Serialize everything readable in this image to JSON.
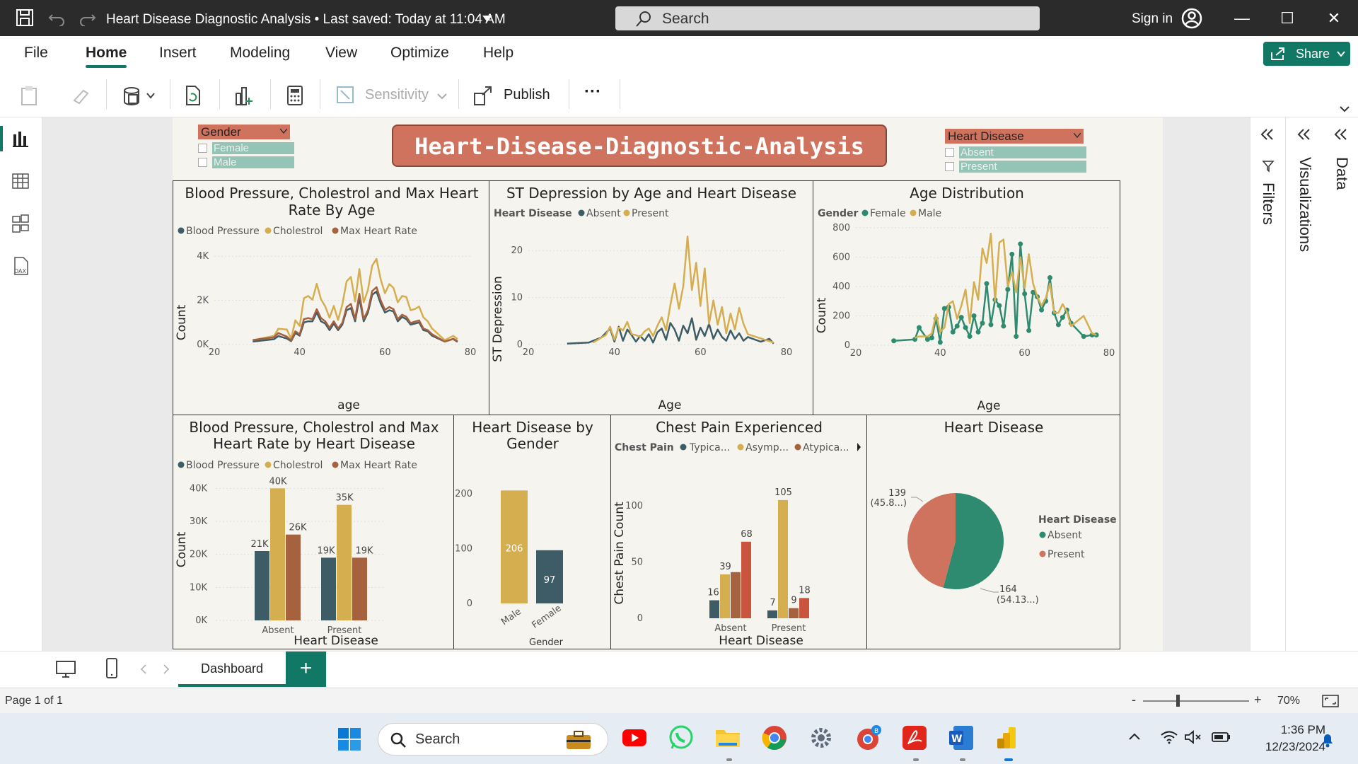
{
  "titlebar": {
    "doc_title": "Heart Disease Diagnostic Analysis",
    "saved_status": "Last saved: Today at 11:04 AM",
    "search_placeholder": "Search",
    "sign_in": "Sign in"
  },
  "menu": {
    "items": [
      "File",
      "Home",
      "Insert",
      "Modeling",
      "View",
      "Optimize",
      "Help"
    ],
    "active": "Home",
    "share": "Share"
  },
  "ribbon": {
    "sensitivity": "Sensitivity",
    "publish": "Publish",
    "more": "···"
  },
  "report": {
    "banner": "Heart-Disease-Diagnostic-Analysis",
    "slicers": [
      {
        "header": "Gender",
        "options": [
          "Female",
          "Male"
        ]
      },
      {
        "header": "Heart Disease",
        "options": [
          "Absent",
          "Present"
        ]
      }
    ]
  },
  "colors": {
    "teal_dark": "#3d5c66",
    "gold": "#d4ae4f",
    "brown": "#a6613f",
    "green": "#2e8b70",
    "salmon": "#d0735e",
    "orange_red": "#c9553f",
    "accent": "#117865"
  },
  "chart_data": [
    {
      "id": "bp_chol_maxhr_by_age",
      "type": "line",
      "title": "Blood Pressure, Cholestrol and Max Heart Rate By Age",
      "xlabel": "age",
      "ylabel": "Count",
      "xlim": [
        20,
        80
      ],
      "yticks": [
        "0K",
        "2K",
        "4K"
      ],
      "xticks": [
        "20",
        "40",
        "60",
        "80"
      ],
      "ylim": [
        0,
        5000
      ],
      "legend": [
        "Blood Pressure",
        "Cholestrol",
        "Max Heart Rate"
      ],
      "x": [
        29,
        34,
        35,
        37,
        38,
        39,
        40,
        41,
        42,
        43,
        44,
        45,
        46,
        47,
        48,
        49,
        50,
        51,
        52,
        53,
        54,
        55,
        56,
        57,
        58,
        59,
        60,
        61,
        62,
        63,
        64,
        65,
        66,
        67,
        68,
        69,
        70,
        71,
        74,
        76,
        77
      ],
      "series": [
        {
          "name": "Blood Pressure",
          "values": [
            130,
            240,
            380,
            270,
            150,
            520,
            400,
            1000,
            1050,
            1050,
            1450,
            1050,
            950,
            650,
            950,
            650,
            900,
            1550,
            1650,
            1050,
            2100,
            1050,
            1450,
            2250,
            2400,
            1850,
            1450,
            1550,
            1500,
            1050,
            1250,
            1150,
            900,
            950,
            1000,
            650,
            600,
            400,
            130,
            250,
            120
          ]
        },
        {
          "name": "Cholestrol",
          "values": [
            200,
            390,
            710,
            680,
            260,
            1100,
            840,
            2100,
            2200,
            2030,
            2750,
            2050,
            1720,
            1210,
            1750,
            1110,
            1810,
            2860,
            3060,
            1950,
            3420,
            1910,
            2470,
            3570,
            3880,
            2940,
            2320,
            2740,
            2560,
            1910,
            2200,
            2150,
            1550,
            1610,
            1720,
            1230,
            1050,
            730,
            200,
            390,
            250
          ]
        },
        {
          "name": "Max Heart Rate",
          "values": [
            200,
            330,
            520,
            360,
            180,
            600,
            460,
            1150,
            1200,
            1150,
            1600,
            1200,
            1050,
            750,
            1050,
            730,
            980,
            1690,
            1840,
            1150,
            2300,
            1150,
            1550,
            2420,
            2600,
            2000,
            1570,
            1700,
            1600,
            1150,
            1350,
            1260,
            970,
            1040,
            1090,
            720,
            650,
            470,
            130,
            260,
            150
          ]
        }
      ]
    },
    {
      "id": "st_depression_by_age",
      "type": "line",
      "title": "ST Depression by Age and Heart Disease",
      "xlabel": "Age",
      "ylabel": "ST Depression",
      "legend_title": "Heart Disease",
      "legend": [
        "Absent",
        "Present"
      ],
      "xlim": [
        20,
        80
      ],
      "ylim": [
        0,
        25
      ],
      "yticks": [
        "0",
        "10",
        "20"
      ],
      "xticks": [
        "20",
        "40",
        "60",
        "80"
      ],
      "series": [
        {
          "name": "Absent",
          "x": [
            29,
            34,
            37,
            39,
            40,
            41,
            42,
            43,
            44,
            45,
            46,
            47,
            48,
            49,
            50,
            51,
            52,
            53,
            54,
            55,
            56,
            57,
            58,
            59,
            60,
            61,
            62,
            63,
            64,
            65,
            66,
            67,
            68,
            69,
            70,
            71,
            74,
            76,
            77
          ],
          "values": [
            0.2,
            0.4,
            1.5,
            3.4,
            0.6,
            3.8,
            0.8,
            3.2,
            2.0,
            0.6,
            1.8,
            0.8,
            2.2,
            0.4,
            2.6,
            3.4,
            1.0,
            4.6,
            3.2,
            0.8,
            4.0,
            2.4,
            5.6,
            1.0,
            3.6,
            1.8,
            4.4,
            1.2,
            3.2,
            1.6,
            0.8,
            3.0,
            1.2,
            2.4,
            0.8,
            1.6,
            0.6,
            1.2,
            0.2
          ]
        },
        {
          "name": "Present",
          "x": [
            35,
            38,
            39,
            40,
            41,
            42,
            43,
            44,
            45,
            46,
            47,
            48,
            49,
            50,
            51,
            52,
            53,
            54,
            55,
            56,
            57,
            58,
            59,
            60,
            61,
            62,
            63,
            64,
            65,
            66,
            67,
            68,
            69,
            70,
            71,
            77
          ],
          "values": [
            0.4,
            2.0,
            3.8,
            1.0,
            3.6,
            3.0,
            4.8,
            2.2,
            2.0,
            1.6,
            2.8,
            3.4,
            1.8,
            4.0,
            5.8,
            3.0,
            8.4,
            13.0,
            7.6,
            12.4,
            23.0,
            11.6,
            17.4,
            8.2,
            16.2,
            4.4,
            9.4,
            4.2,
            8.0,
            2.4,
            6.6,
            3.2,
            7.8,
            4.4,
            2.2,
            0.4
          ]
        }
      ]
    },
    {
      "id": "age_distribution",
      "type": "line",
      "title": "Age Distribution",
      "xlabel": "Age",
      "ylabel": "Count",
      "legend_title": "Gender",
      "legend": [
        "Female",
        "Male"
      ],
      "xlim": [
        20,
        80
      ],
      "ylim": [
        0,
        800
      ],
      "yticks": [
        "0",
        "200",
        "400",
        "600",
        "800"
      ],
      "xticks": [
        "20",
        "40",
        "60",
        "80"
      ],
      "series": [
        {
          "name": "Female",
          "x": [
            29,
            34,
            35,
            37,
            38,
            39,
            40,
            41,
            42,
            43,
            44,
            45,
            46,
            47,
            48,
            49,
            50,
            51,
            52,
            53,
            54,
            55,
            56,
            57,
            58,
            59,
            60,
            61,
            62,
            63,
            64,
            65,
            66,
            67,
            68,
            69,
            70,
            71,
            74,
            76,
            77
          ],
          "values": [
            30,
            40,
            120,
            40,
            50,
            180,
            20,
            250,
            260,
            90,
            130,
            190,
            120,
            60,
            200,
            90,
            150,
            420,
            140,
            310,
            270,
            130,
            380,
            620,
            60,
            690,
            350,
            100,
            360,
            330,
            240,
            300,
            460,
            220,
            140,
            190,
            240,
            150,
            60,
            70,
            70
          ]
        },
        {
          "name": "Male",
          "x": [
            34,
            35,
            37,
            38,
            39,
            40,
            41,
            42,
            43,
            44,
            45,
            46,
            47,
            48,
            49,
            50,
            51,
            52,
            53,
            54,
            55,
            56,
            57,
            58,
            59,
            60,
            61,
            62,
            63,
            64,
            65,
            66,
            67,
            68,
            69,
            70,
            71,
            74,
            76,
            77
          ],
          "values": [
            50,
            60,
            60,
            80,
            210,
            90,
            120,
            280,
            300,
            180,
            270,
            380,
            150,
            430,
            310,
            660,
            560,
            760,
            300,
            700,
            720,
            400,
            500,
            360,
            600,
            390,
            620,
            420,
            330,
            270,
            320,
            420,
            220,
            220,
            280,
            230,
            130,
            200,
            80,
            70
          ]
        }
      ]
    },
    {
      "id": "bp_chol_maxhr_by_hd",
      "type": "bar",
      "title": "Blood Pressure, Cholestrol and Max Heart Rate by Heart Disease",
      "xlabel": "Heart Disease",
      "ylabel": "Count",
      "categories": [
        "Absent",
        "Present"
      ],
      "ylim": [
        0,
        45000
      ],
      "yticks": [
        "0K",
        "10K",
        "20K",
        "30K",
        "40K"
      ],
      "legend": [
        "Blood Pressure",
        "Cholestrol",
        "Max Heart Rate"
      ],
      "series": [
        {
          "name": "Blood Pressure",
          "values": [
            21000,
            19000
          ],
          "labels": [
            "21K",
            "19K"
          ]
        },
        {
          "name": "Cholestrol",
          "values": [
            40000,
            35000
          ],
          "labels": [
            "40K",
            "35K"
          ]
        },
        {
          "name": "Max Heart Rate",
          "values": [
            26000,
            19000
          ],
          "labels": [
            "26K",
            "19K"
          ]
        }
      ]
    },
    {
      "id": "hd_by_gender",
      "type": "bar",
      "title": "Heart Disease by Gender",
      "xlabel": "Gender",
      "categories": [
        "Male",
        "Female"
      ],
      "values": [
        206,
        97
      ],
      "ylim": [
        0,
        240
      ],
      "yticks": [
        "0",
        "100",
        "200"
      ]
    },
    {
      "id": "chest_pain",
      "type": "bar",
      "title": "Chest Pain Experienced",
      "xlabel": "Heart Disease",
      "ylabel": "Chest Pain Count",
      "legend_title": "Chest Pain",
      "legend": [
        "Typica...",
        "Asymp...",
        "Atypica..."
      ],
      "categories": [
        "Absent",
        "Present"
      ],
      "ylim": [
        0,
        120
      ],
      "yticks": [
        "0",
        "50",
        "100"
      ],
      "bars": [
        {
          "category": "Absent",
          "values": [
            16,
            39,
            41,
            68
          ],
          "labels": [
            "16",
            "39",
            "",
            "68"
          ]
        },
        {
          "category": "Present",
          "values": [
            7,
            105,
            9,
            18
          ],
          "labels": [
            "7",
            "105",
            "9",
            "18"
          ]
        }
      ]
    },
    {
      "id": "heart_disease_pie",
      "type": "pie",
      "title": "Heart Disease",
      "legend_title": "Heart Disease",
      "legend": [
        "Absent",
        "Present"
      ],
      "values": [
        164,
        139
      ],
      "labels": [
        "164",
        "139"
      ],
      "pct_labels": [
        "(54.13...)",
        "(45.8...)"
      ]
    }
  ],
  "tabs": {
    "page": "Dashboard",
    "add": "+"
  },
  "status": {
    "page": "Page 1 of 1",
    "zoom": "70%"
  },
  "taskbar": {
    "search": "Search",
    "time": "1:36 PM",
    "date": "12/23/2024"
  },
  "panes": {
    "filters": "Filters",
    "visualizations": "Visualizations",
    "data": "Data"
  }
}
